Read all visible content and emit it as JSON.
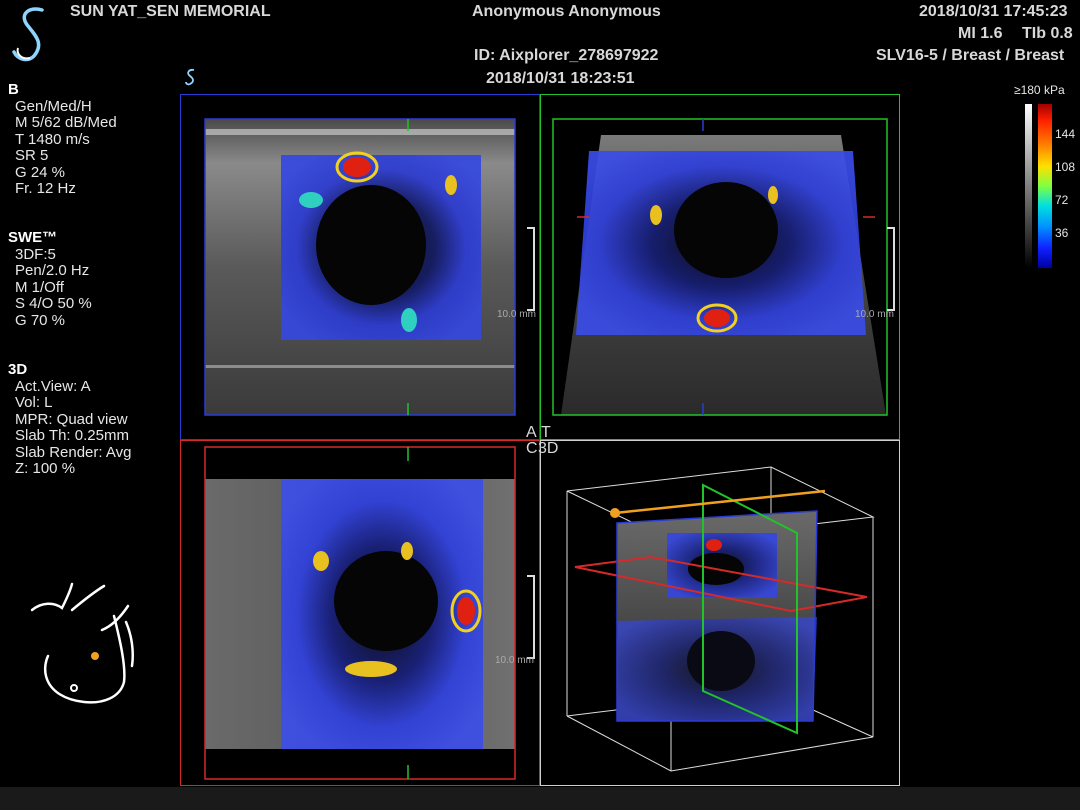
{
  "header": {
    "institution": "SUN YAT_SEN MEMORIAL",
    "patient_name": "Anonymous Anonymous",
    "patient_id": "ID: Aixplorer_278697922",
    "acq_datetime": "2018/10/31 18:23:51",
    "current_datetime": "2018/10/31 17:45:23",
    "mi": "MI 1.6",
    "tib": "TIb 0.8",
    "probe_preset": "SLV16-5 / Breast / Breast"
  },
  "sidebar": {
    "b_mode": {
      "title": "B",
      "lines": [
        "Gen/Med/H",
        "M 5/62 dB/Med",
        "T 1480 m/s",
        "SR 5",
        "G 24 %",
        "Fr. 12 Hz"
      ]
    },
    "swe": {
      "title": "SWE™",
      "lines": [
        "3DF:5",
        "Pen/2.0 Hz",
        "M 1/Off",
        "S 4/O 50 %",
        "G 70 %"
      ]
    },
    "three_d": {
      "title": "3D",
      "lines": [
        "Act.View: A",
        "Vol: L",
        "MPR: Quad view",
        "Slab Th: 0.25mm",
        "Slab Render: Avg",
        "Z: 100 %"
      ]
    }
  },
  "views": {
    "label_a": "A",
    "label_t": "T",
    "label_c": "C",
    "label_3d": "3D",
    "depth_label": "10.0 mm"
  },
  "colorbar": {
    "max_label": "≥180 kPa",
    "ticks": [
      "144",
      "108",
      "72",
      "36"
    ]
  },
  "icons": {
    "logo": "supersonic-logo-icon",
    "small_logo": "supersonic-small-logo-icon",
    "body_marker": "breast-body-marker-icon"
  },
  "colors": {
    "view_a": "#2b3bd6",
    "view_t": "#22c22a",
    "view_c": "#d42a2a",
    "view_3d": "#cfcfcf",
    "accent_orange": "#f0a020"
  }
}
